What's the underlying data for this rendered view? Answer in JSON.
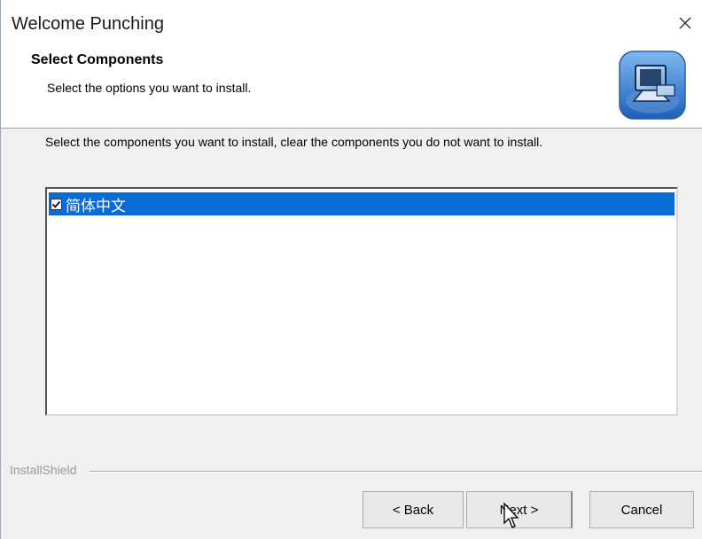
{
  "window": {
    "title": "Welcome Punching",
    "close_glyph": "×"
  },
  "header": {
    "title": "Select Components",
    "subtitle": "Select the options you want to install.",
    "logo_icon": "installer-computer-icon"
  },
  "instruction": "Select the components you want to install, clear the components you do not want to install.",
  "components": [
    {
      "label": "简体中文",
      "checked": true,
      "selected": true
    }
  ],
  "footer": {
    "brand": "InstallShield",
    "back_label": "< Back",
    "next_label": "Next >",
    "cancel_label": "Cancel"
  },
  "colors": {
    "selection": "#0a6ad6",
    "window_bg": "#f0f0f0",
    "header_bg": "#ffffff"
  }
}
